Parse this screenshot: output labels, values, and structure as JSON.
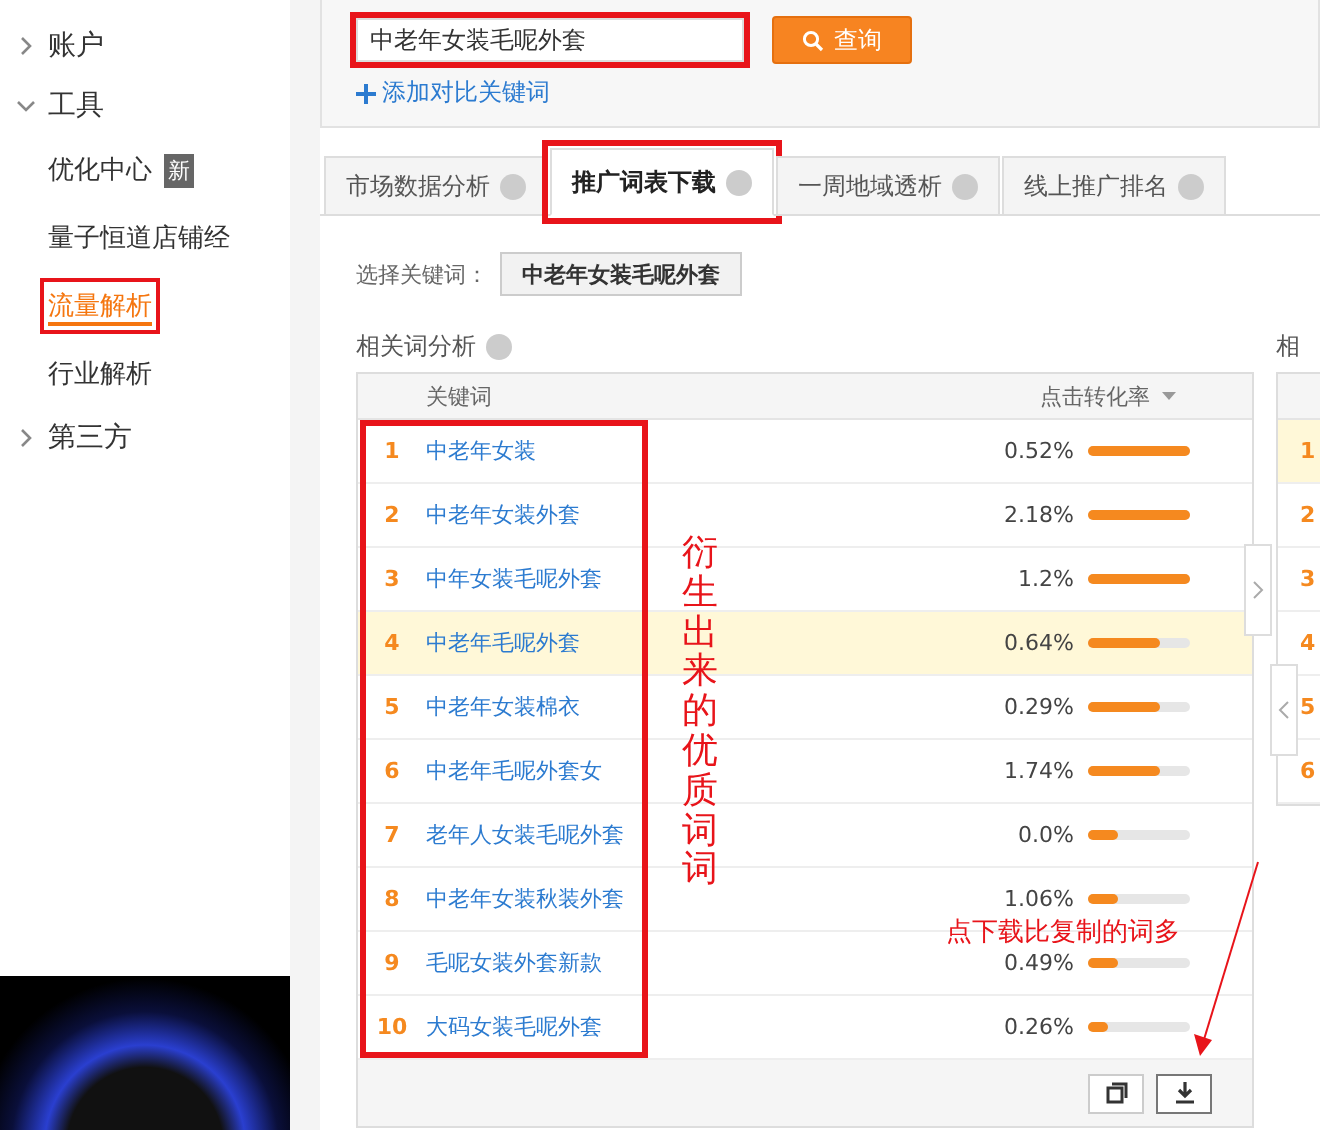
{
  "sidebar": {
    "sections": [
      {
        "label": "账户",
        "expanded": false
      },
      {
        "label": "工具",
        "expanded": true,
        "children": [
          {
            "label": "优化中心",
            "badge": "新",
            "selected": false,
            "red_box": false
          },
          {
            "label": "量子恒道店铺经",
            "selected": false,
            "red_box": false
          },
          {
            "label": "流量解析",
            "selected": true,
            "red_box": true
          },
          {
            "label": "行业解析",
            "selected": false,
            "red_box": false
          }
        ]
      },
      {
        "label": "第三方",
        "expanded": false
      }
    ]
  },
  "search": {
    "value": "中老年女装毛呢外套",
    "red_box": true,
    "button": "查询",
    "add_compare": "添加对比关键词"
  },
  "tabs": [
    {
      "label": "市场数据分析",
      "selected": false,
      "red_box": false
    },
    {
      "label": "推广词表下载",
      "selected": true,
      "red_box": true
    },
    {
      "label": "一周地域透析",
      "selected": false,
      "red_box": false
    },
    {
      "label": "线上推广排名",
      "selected": false,
      "red_box": false
    }
  ],
  "keyword_select": {
    "label": "选择关键词：",
    "value": "中老年女装毛呢外套"
  },
  "related_panel": {
    "title": "相关词分析",
    "columns": [
      "关键词",
      "点击转化率"
    ],
    "keyword_red_box": true,
    "rows": [
      {
        "rank": "1",
        "keyword": "中老年女装",
        "rate": "0.52%",
        "level": 1.0,
        "highlighted": false
      },
      {
        "rank": "2",
        "keyword": "中老年女装外套",
        "rate": "2.18%",
        "level": 1.0,
        "highlighted": false
      },
      {
        "rank": "3",
        "keyword": "中年女装毛呢外套",
        "rate": "1.2%",
        "level": 1.0,
        "highlighted": false
      },
      {
        "rank": "4",
        "keyword": "中老年毛呢外套",
        "rate": "0.64%",
        "level": 0.7,
        "highlighted": true
      },
      {
        "rank": "5",
        "keyword": "中老年女装棉衣",
        "rate": "0.29%",
        "level": 0.7,
        "highlighted": false
      },
      {
        "rank": "6",
        "keyword": "中老年毛呢外套女",
        "rate": "1.74%",
        "level": 0.7,
        "highlighted": false
      },
      {
        "rank": "7",
        "keyword": "老年人女装毛呢外套",
        "rate": "0.0%",
        "level": 0.3,
        "highlighted": false
      },
      {
        "rank": "8",
        "keyword": "中老年女装秋装外套",
        "rate": "1.06%",
        "level": 0.3,
        "highlighted": false
      },
      {
        "rank": "9",
        "keyword": "毛呢女装外套新款",
        "rate": "0.49%",
        "level": 0.3,
        "highlighted": false
      },
      {
        "rank": "10",
        "keyword": "大码女装毛呢外套",
        "rate": "0.26%",
        "level": 0.2,
        "highlighted": false
      }
    ]
  },
  "side_panel": {
    "title": "相",
    "rows": [
      {
        "rank": "1",
        "highlighted": true
      },
      {
        "rank": "2",
        "highlighted": false
      },
      {
        "rank": "3",
        "highlighted": false
      },
      {
        "rank": "4",
        "highlighted": false
      },
      {
        "rank": "5",
        "highlighted": false
      },
      {
        "rank": "6",
        "highlighted": false
      }
    ]
  },
  "annotations": [
    {
      "kind": "vertical_note",
      "text": "衍生出来的优质词词"
    },
    {
      "kind": "arrow_note",
      "text": "点下载比复制的词多"
    }
  ]
}
